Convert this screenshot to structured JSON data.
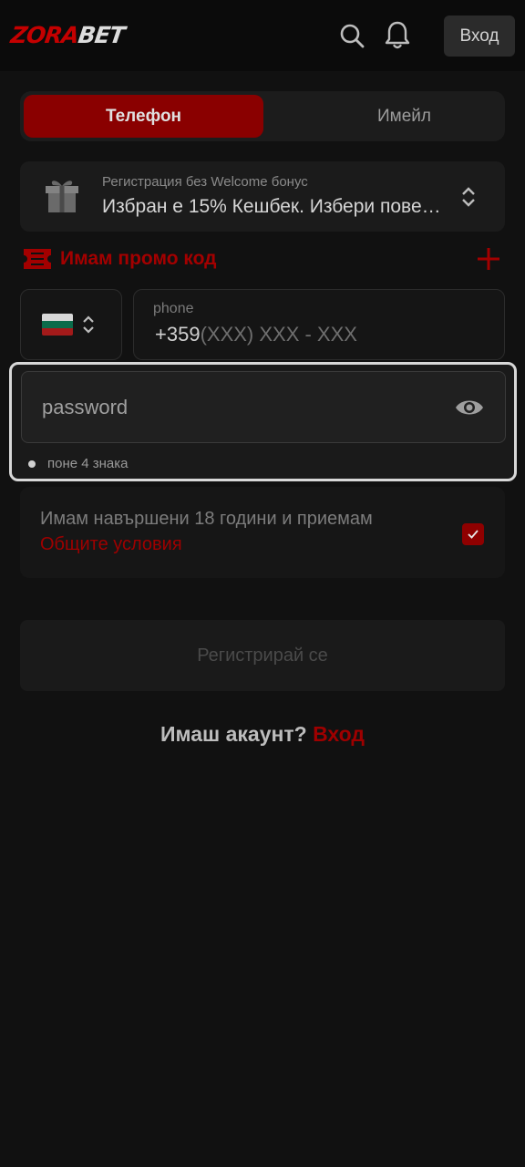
{
  "header": {
    "logo_part1": "ZORA",
    "logo_part2": "BET",
    "login_label": "Вход",
    "icons": [
      "search-icon",
      "bell-icon"
    ]
  },
  "tabs": [
    {
      "label": "Телефон",
      "active": true
    },
    {
      "label": "Имейл",
      "active": false
    }
  ],
  "bonus": {
    "subtitle": "Регистрация без Welcome бонус",
    "selected": "Избран е 15% Кешбек. Избери пове…",
    "icon": "gift-icon"
  },
  "promo": {
    "label": "Имам промо код",
    "icon": "ticket-icon",
    "expand_icon": "plus-icon"
  },
  "phone": {
    "country_flag": "bg-flag",
    "label": "phone",
    "code": "+359",
    "mask": "(XXX) XXX - XXX"
  },
  "password": {
    "placeholder": "password",
    "hint": "поне 4 знака",
    "icon": "eye-icon"
  },
  "terms": {
    "text": "Имам навършени 18 години и приемам",
    "link": "Общите условия",
    "checked": true
  },
  "submit_label": "Регистрирай се",
  "footer": {
    "question": "Имаш акаунт?",
    "link": "Вход"
  },
  "colors": {
    "accent": "#8a0000",
    "background": "#111111",
    "link": "#9e0000"
  }
}
